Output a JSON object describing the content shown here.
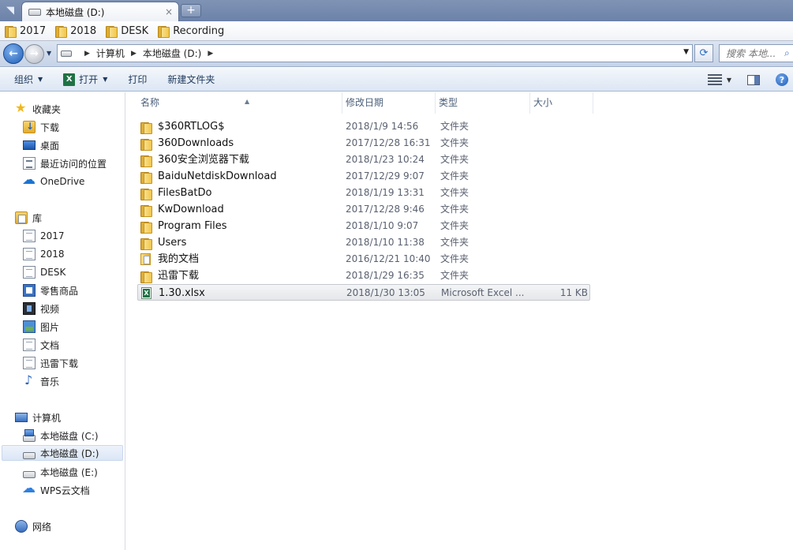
{
  "tab": {
    "title": "本地磁盘 (D:)",
    "close": "×",
    "new": "+"
  },
  "bookmarks": [
    {
      "label": "2017"
    },
    {
      "label": "2018"
    },
    {
      "label": "DESK"
    },
    {
      "label": "Recording"
    }
  ],
  "address": {
    "crumbs": [
      "计算机",
      "本地磁盘 (D:)"
    ],
    "search_placeholder": "搜索 本地..."
  },
  "toolbar": {
    "organize": "组织",
    "open": "打开",
    "print": "打印",
    "new_folder": "新建文件夹"
  },
  "nav": {
    "favorites": {
      "header": "收藏夹",
      "items": [
        {
          "label": "下载",
          "icon": "download-folder-icon"
        },
        {
          "label": "桌面",
          "icon": "desktop-icon"
        },
        {
          "label": "最近访问的位置",
          "icon": "recent-places-icon"
        },
        {
          "label": "OneDrive",
          "icon": "onedrive-icon"
        }
      ]
    },
    "libraries": {
      "header": "库",
      "items": [
        {
          "label": "2017"
        },
        {
          "label": "2018"
        },
        {
          "label": "DESK"
        },
        {
          "label": "零售商品"
        },
        {
          "label": "视频"
        },
        {
          "label": "图片"
        },
        {
          "label": "文档"
        },
        {
          "label": "迅雷下载"
        },
        {
          "label": "音乐"
        }
      ]
    },
    "computer": {
      "header": "计算机",
      "items": [
        {
          "label": "本地磁盘 (C:)"
        },
        {
          "label": "本地磁盘 (D:)",
          "selected": true
        },
        {
          "label": "本地磁盘 (E:)"
        },
        {
          "label": "WPS云文档"
        }
      ]
    },
    "network": {
      "header": "网络"
    }
  },
  "columns": {
    "name": "名称",
    "date": "修改日期",
    "type": "类型",
    "size": "大小"
  },
  "files": [
    {
      "name": "$360RTLOG$",
      "date": "2018/1/9 14:56",
      "type": "文件夹",
      "size": "",
      "kind": "folder"
    },
    {
      "name": "360Downloads",
      "date": "2017/12/28 16:31",
      "type": "文件夹",
      "size": "",
      "kind": "folder"
    },
    {
      "name": "360安全浏览器下载",
      "date": "2018/1/23 10:24",
      "type": "文件夹",
      "size": "",
      "kind": "folder"
    },
    {
      "name": "BaiduNetdiskDownload",
      "date": "2017/12/29 9:07",
      "type": "文件夹",
      "size": "",
      "kind": "folder"
    },
    {
      "name": "FilesBatDo",
      "date": "2018/1/19 13:31",
      "type": "文件夹",
      "size": "",
      "kind": "folder"
    },
    {
      "name": "KwDownload",
      "date": "2017/12/28 9:46",
      "type": "文件夹",
      "size": "",
      "kind": "folder"
    },
    {
      "name": "Program Files",
      "date": "2018/1/10 9:07",
      "type": "文件夹",
      "size": "",
      "kind": "folder"
    },
    {
      "name": "Users",
      "date": "2018/1/10 11:38",
      "type": "文件夹",
      "size": "",
      "kind": "folder"
    },
    {
      "name": "我的文档",
      "date": "2016/12/21 10:40",
      "type": "文件夹",
      "size": "",
      "kind": "doc-folder"
    },
    {
      "name": "迅雷下载",
      "date": "2018/1/29 16:35",
      "type": "文件夹",
      "size": "",
      "kind": "folder"
    },
    {
      "name": "1.30.xlsx",
      "date": "2018/1/30 13:05",
      "type": "Microsoft Excel ...",
      "size": "11 KB",
      "kind": "excel",
      "selected": true
    }
  ]
}
